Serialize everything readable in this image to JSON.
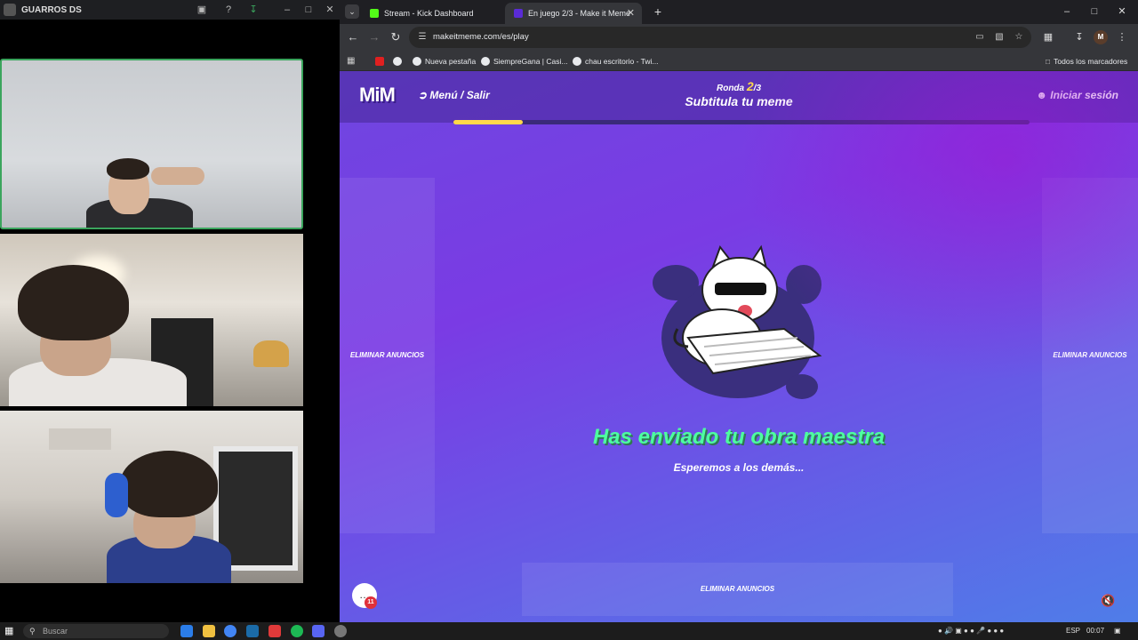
{
  "call_window": {
    "title": "GUARROS DS"
  },
  "browser": {
    "tabs": [
      {
        "label": "Stream - Kick Dashboard",
        "favicon_color": "#53fc18"
      },
      {
        "label": "En juego 2/3 - Make it Meme",
        "favicon_color": "#5a2bd6"
      }
    ],
    "url": "makeitmeme.com/es/play",
    "bookmarks": [
      {
        "label": "Nueva pestaña"
      },
      {
        "label": "SiempreGana | Casi..."
      },
      {
        "label": "chau escritorio - Twi..."
      }
    ],
    "all_bookmarks_label": "Todos los marcadores",
    "profile_initial": "M"
  },
  "page": {
    "logo": "MiM",
    "menu_label": "Menú / Salir",
    "round_label": "Ronda",
    "round_current": "2",
    "round_total": "/3",
    "phase_title": "Subtitula tu meme",
    "login_label": "Iniciar sesión",
    "round_progress_percent": 12,
    "ad_labels": {
      "left": "Eliminar anuncios",
      "right": "Eliminar anuncios",
      "bottom": "Eliminar anuncios"
    },
    "done_title": "Has enviado tu obra maestra",
    "done_subtitle": "Esperemos a los demás...",
    "chat_badge": "11",
    "accent_color": "#4dffa0",
    "highlight_color": "#ffd84a"
  },
  "taskbar": {
    "search_placeholder": "Buscar",
    "language": "ESP",
    "time": "00:07"
  }
}
